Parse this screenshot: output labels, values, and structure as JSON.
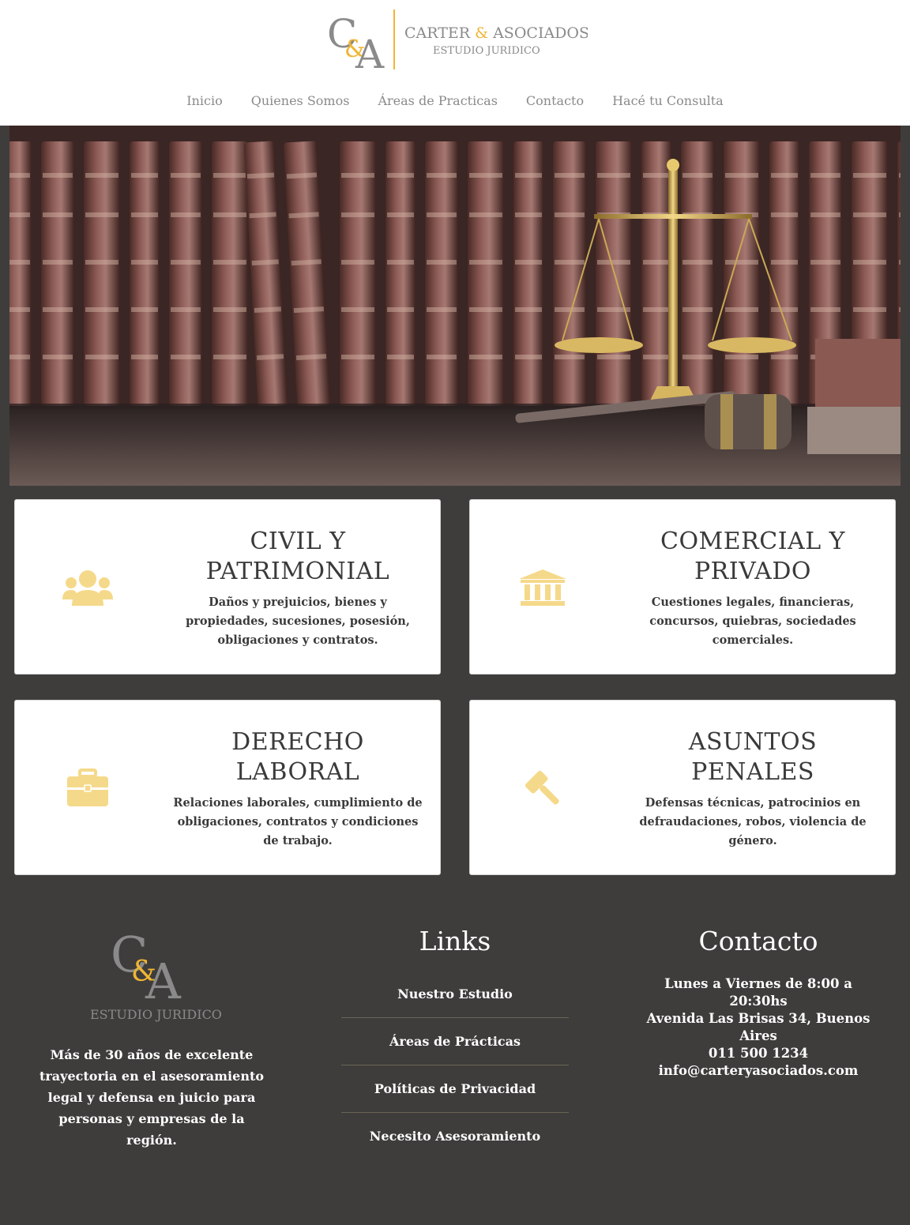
{
  "brand": {
    "monogram_c": "C",
    "monogram_amp": "&",
    "monogram_a": "A",
    "name_part1": "CARTER ",
    "name_amp": "&",
    "name_part2": " ASOCIADOS",
    "subtitle": "ESTUDIO JURIDICO",
    "colors": {
      "gold": "#f0b533",
      "gray": "#8a8a8a",
      "icon_gold": "#f5d98a"
    }
  },
  "nav": {
    "items": [
      {
        "label": "Inicio"
      },
      {
        "label": "Quienes Somos"
      },
      {
        "label": "Áreas de Practicas"
      },
      {
        "label": "Contacto"
      },
      {
        "label": "Hacé tu Consulta"
      }
    ]
  },
  "cards": [
    {
      "icon": "users-icon",
      "title_line1": "CIVIL Y",
      "title_line2": "PATRIMONIAL",
      "description": "Daños y prejuicios, bienes y propiedades, sucesiones, posesión, obligaciones y contratos."
    },
    {
      "icon": "bank-icon",
      "title_line1": "COMERCIAL Y",
      "title_line2": "PRIVADO",
      "description": "Cuestiones legales, financieras, concursos, quiebras, sociedades comerciales."
    },
    {
      "icon": "briefcase-icon",
      "title_line1": "DERECHO",
      "title_line2": "LABORAL",
      "description": "Relaciones laborales, cumplimiento de obligaciones, contratos y condiciones de trabajo."
    },
    {
      "icon": "gavel-icon",
      "title_line1": "ASUNTOS",
      "title_line2": "PENALES",
      "description": "Defensas técnicas, patrocinios en defraudaciones, robos, violencia de género."
    }
  ],
  "footer": {
    "logo_subtitle": "ESTUDIO JURIDICO",
    "description": "Más de 30 años de excelente trayectoria en el asesoramiento legal y defensa en juicio para personas y empresas de la región.",
    "links_title": "Links",
    "links": [
      {
        "label": "Nuestro Estudio"
      },
      {
        "label": "Áreas de Prácticas"
      },
      {
        "label": "Políticas de Privacidad"
      },
      {
        "label": "Necesito Asesoramiento"
      }
    ],
    "contact_title": "Contacto",
    "contact": {
      "hours": "Lunes a Viernes de 8:00 a 20:30hs",
      "address": "Avenida Las Brisas 34, Buenos Aires",
      "phone": "011 500 1234",
      "email": "info@carteryasociados.com"
    }
  }
}
